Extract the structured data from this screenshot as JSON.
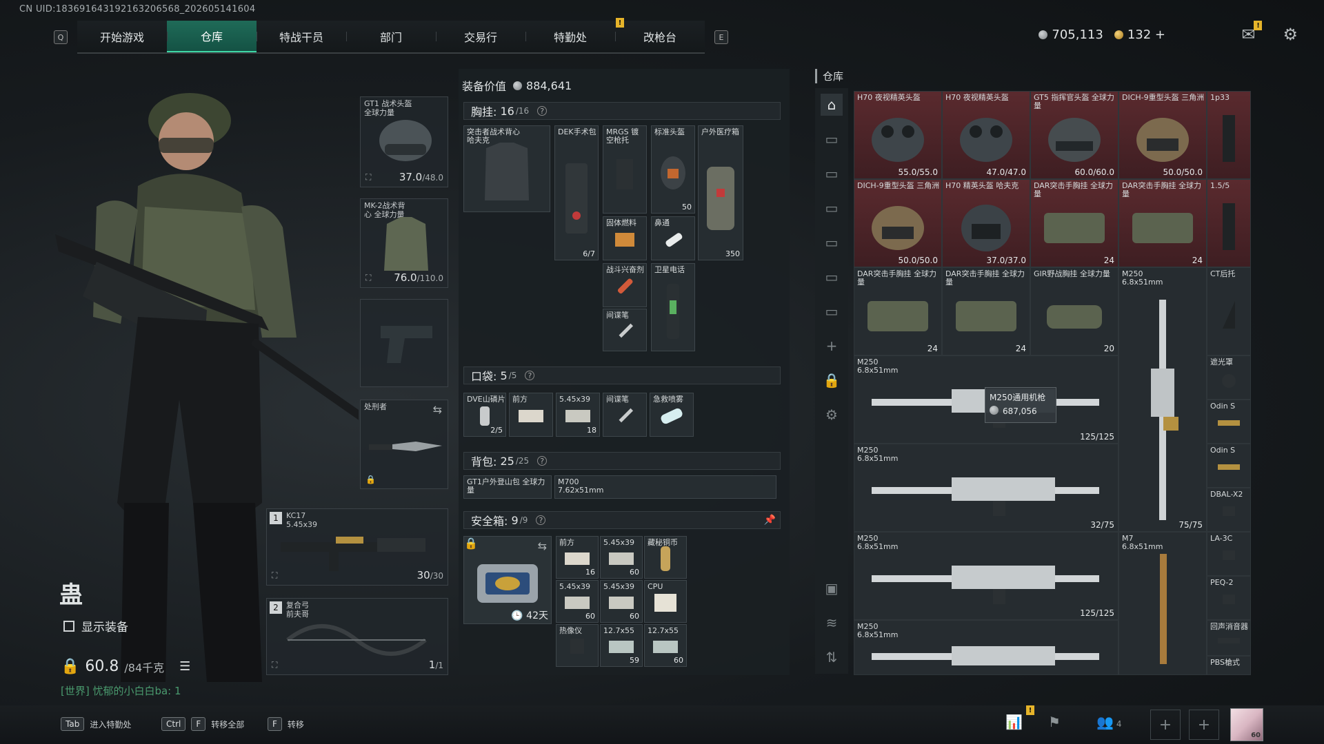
{
  "header": {
    "uid": "CN UID:1836916431921632065​68_202605141604",
    "left_key": "Q",
    "right_key": "E",
    "tabs": [
      {
        "label": "开始游戏"
      },
      {
        "label": "仓库"
      },
      {
        "label": "特战干员"
      },
      {
        "label": "部门"
      },
      {
        "label": "交易行"
      },
      {
        "label": "特勤处"
      },
      {
        "label": "改枪台"
      }
    ],
    "alert_mark": "!",
    "currency_silver": "705,113",
    "currency_gold": "132",
    "add_symbol": "+"
  },
  "operator": {
    "name": "蛊",
    "show_equipment_label": "显示装备",
    "weight_value": "60.8",
    "weight_max": "/84千克",
    "chat": "[世界] 忧郁的小白白ba: 1"
  },
  "gear_slots": {
    "helmet": {
      "label": "GT1 战术头盔 全球力量",
      "dur": "37.0",
      "dur_max": "/48.0"
    },
    "armor": {
      "label": "MK-2战术背心 全球力量",
      "dur": "76.0",
      "dur_max": "/110.0"
    },
    "melee": {
      "label": "处刑者"
    },
    "primary": {
      "index": "1",
      "name": "KC17",
      "caliber": "5.45x39",
      "ammo": "30",
      "ammo_max": "/30"
    },
    "secondary": {
      "index": "2",
      "name": "复合弓",
      "sub": "前夫哥",
      "ammo": "1",
      "ammo_max": "/1"
    }
  },
  "loadout": {
    "equipment_value_label": "装备价值",
    "equipment_value": "884,641",
    "chest_rig": {
      "label": "胸挂:",
      "count": "16",
      "max": "/16"
    },
    "chest_items": [
      {
        "name": "突击者战术背心 哈夫克"
      },
      {
        "name": "DEK手术包",
        "count": "6/7"
      },
      {
        "name": "MRGS 镀空枪托"
      },
      {
        "name": "标准头盔",
        "count": "50"
      },
      {
        "name": "户外医疗箱",
        "count": "350"
      },
      {
        "name": "固体燃料"
      },
      {
        "name": "鼻通"
      },
      {
        "name": "战斗兴奋剂"
      },
      {
        "name": "卫星电话"
      },
      {
        "name": "间谍笔"
      }
    ],
    "pockets": {
      "label": "口袋:",
      "count": "5",
      "max": "/5"
    },
    "pocket_items": [
      {
        "name": "DVE山磷片",
        "count": "2/5"
      },
      {
        "name": "前方"
      },
      {
        "name": "5.45x39",
        "count": "18"
      },
      {
        "name": "间谍笔"
      },
      {
        "name": "急救喷雾"
      }
    ],
    "backpack": {
      "label": "背包:",
      "count": "25",
      "max": "/25"
    },
    "backpack_items": [
      {
        "name": "GT1户外登山包 全球力量"
      },
      {
        "name": "M700",
        "sub": "7.62x51mm"
      }
    ],
    "safebox": {
      "label": "安全箱:",
      "count": "9",
      "max": "/9",
      "days": "42天"
    },
    "safebox_items": [
      {
        "name": "前方",
        "count": "16"
      },
      {
        "name": "5.45x39",
        "count": "60"
      },
      {
        "name": "藏秘铜币"
      },
      {
        "name": "5.45x39",
        "count": "60"
      },
      {
        "name": "5.45x39",
        "count": "60"
      },
      {
        "name": "CPU"
      },
      {
        "name": "热像仪"
      },
      {
        "name": "12.7x55",
        "count": "59"
      },
      {
        "name": "12.7x55",
        "count": "60"
      }
    ]
  },
  "warehouse": {
    "title": "仓库",
    "items": [
      {
        "name": "H70 夜视精英头盔",
        "count": "55.0/55.0"
      },
      {
        "name": "H70 夜视精英头盔",
        "count": "47.0/47.0"
      },
      {
        "name": "GT5 指挥官头盔 全球力量",
        "count": "60.0/60.0"
      },
      {
        "name": "DICH-9重型头盔 三角洲",
        "count": "50.0/50.0"
      },
      {
        "name": "1p33"
      },
      {
        "name": "DICH-9重型头盔 三角洲",
        "count": "50.0/50.0"
      },
      {
        "name": "H70 精英头盔 哈夫克",
        "count": "37.0/37.0"
      },
      {
        "name": "DAR突击手胸挂 全球力量",
        "count": "24"
      },
      {
        "name": "DAR突击手胸挂 全球力量",
        "count": "24"
      },
      {
        "name": "1.5/5"
      },
      {
        "name": "DAR突击手胸挂 全球力量",
        "count": "24"
      },
      {
        "name": "DAR突击手胸挂 全球力量",
        "count": "24"
      },
      {
        "name": "GIR野战胸挂 全球力量",
        "count": "20"
      },
      {
        "name": "M250",
        "sub": "6.8x51mm",
        "count": "75/75"
      },
      {
        "name": "CT后托"
      },
      {
        "name": "M250",
        "sub": "6.8x51mm",
        "count": "125/125"
      },
      {
        "name": "遮光罩"
      },
      {
        "name": "Odin S"
      },
      {
        "name": "M250",
        "sub": "6.8x51mm",
        "count": "32/75"
      },
      {
        "name": "Odin S"
      },
      {
        "name": "DBAL-X2"
      },
      {
        "name": "M250",
        "sub": "6.8x51mm",
        "count": "125/125"
      },
      {
        "name": "M7",
        "sub": "6.8x51mm"
      },
      {
        "name": "LA-3C"
      },
      {
        "name": "PEQ-2"
      },
      {
        "name": "M250",
        "sub": "6.8x51mm"
      },
      {
        "name": "回声消音器"
      },
      {
        "name": "PBS槍式"
      }
    ],
    "tooltip": {
      "name": "M250通用机枪",
      "value": "687,056"
    }
  },
  "bottom": {
    "hints": [
      {
        "key1": "Tab",
        "label": "进入特勤处"
      },
      {
        "key1": "Ctrl",
        "key2": "F",
        "label": "转移全部"
      },
      {
        "key1": "F",
        "label": "转移"
      }
    ],
    "friends_count": "4",
    "avatar_level": "60"
  }
}
